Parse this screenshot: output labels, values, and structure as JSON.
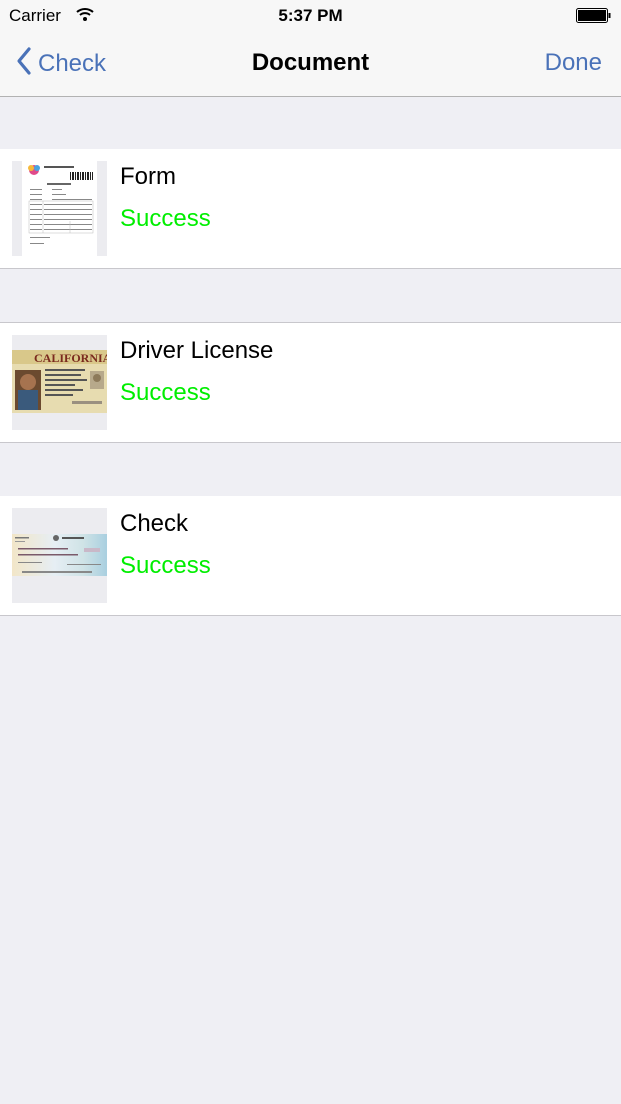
{
  "status_bar": {
    "carrier": "Carrier",
    "time": "5:37 PM"
  },
  "nav": {
    "back_label": "Check",
    "title": "Document",
    "done_label": "Done"
  },
  "documents": [
    {
      "title": "Form",
      "status": "Success",
      "thumbnail": "form-document-thumbnail"
    },
    {
      "title": "Driver License",
      "status": "Success",
      "thumbnail": "driver-license-thumbnail",
      "thumbnail_text": "CALIFORNIA"
    },
    {
      "title": "Check",
      "status": "Success",
      "thumbnail": "check-thumbnail"
    }
  ],
  "colors": {
    "tint": "#4a72b8",
    "success": "#00ee00",
    "background": "#efeff4"
  }
}
